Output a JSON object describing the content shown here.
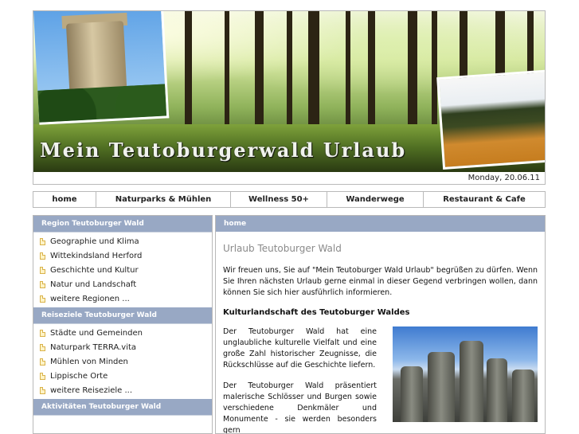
{
  "header": {
    "title": "Mein Teutoburgerwald Urlaub",
    "date": "Monday, 20.06.11"
  },
  "nav": {
    "items": [
      "home",
      "Naturparks & Mühlen",
      "Wellness 50+",
      "Wanderwege",
      "Restaurant & Cafe"
    ]
  },
  "sidebar": {
    "sections": [
      {
        "title": "Region Teutoburger Wald",
        "items": [
          "Geographie und Klima",
          "Wittekindsland Herford",
          "Geschichte und Kultur",
          "Natur und Landschaft",
          "weitere Regionen ..."
        ]
      },
      {
        "title": "Reiseziele Teutoburger Wald",
        "items": [
          "Städte und Gemeinden",
          "Naturpark TERRA.vita",
          "Mühlen von Minden",
          "Lippische Orte",
          "weitere Reiseziele ..."
        ]
      },
      {
        "title": "Aktivitäten Teutoburger Wald",
        "items": []
      }
    ]
  },
  "main": {
    "breadcrumb": "home",
    "title": "Urlaub Teutoburger Wald",
    "intro": "Wir freuen uns, Sie auf \"Mein Teutoburger Wald Urlaub\" begrüßen zu dürfen. Wenn Sie Ihren nächsten Urlaub gerne einmal in dieser Gegend verbringen wollen, dann können Sie sich hier ausführlich informieren.",
    "subheading": "Kulturlandschaft des Teutoburger Waldes",
    "para1": "Der Teutoburger Wald hat eine unglaubliche kulturelle Vielfalt und eine große Zahl historischer Zeugnisse, die Rückschlüsse auf die Geschichte liefern.",
    "para2": "Der Teutoburger Wald präsentiert malerische Schlösser und Burgen sowie verschiedene Denkmäler und Monumente - sie werden besonders gern"
  }
}
